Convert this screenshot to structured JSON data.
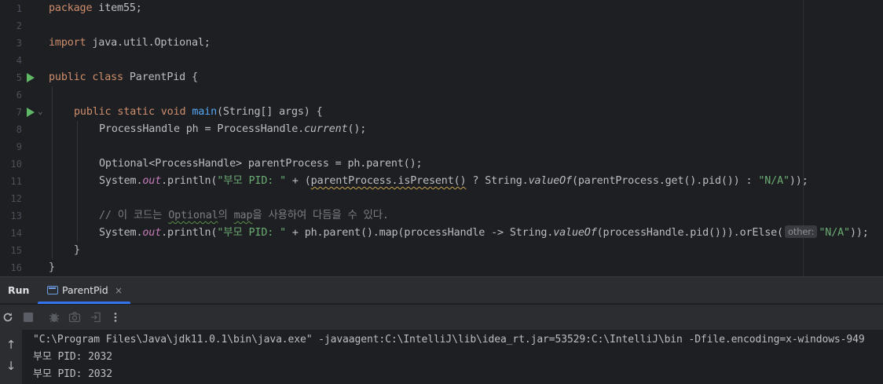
{
  "editor": {
    "line_numbers": [
      "1",
      "2",
      "3",
      "4",
      "5",
      "6",
      "7",
      "8",
      "9",
      "10",
      "11",
      "12",
      "13",
      "14",
      "15",
      "16"
    ],
    "line1": {
      "kw": "package",
      "rest": " item55;"
    },
    "line3": {
      "kw": "import",
      "rest": " java.util.Optional;"
    },
    "line5": {
      "kw": "public class",
      "rest": " ParentPid {"
    },
    "line7": {
      "kw": "public static void",
      "fn": "main",
      "rest": "(String[] args) {"
    },
    "line8": {
      "a": "ProcessHandle ph = ProcessHandle.",
      "b": "current",
      "c": "();"
    },
    "line10": {
      "a": "Optional<ProcessHandle> parentProcess = ph.parent();"
    },
    "line11": {
      "a": "System.",
      "field": "out",
      "b": ".println(",
      "str1": "\"부모 PID: \"",
      "c": " + (",
      "warn": "parentProcess.isPresent()",
      "d": " ? String.",
      "ital": "valueOf",
      "e": "(parentProcess.get().pid()) : ",
      "str2": "\"N/A\"",
      "f": "));"
    },
    "line13": {
      "a": "// 이 코드는 ",
      "typo1": "Optional",
      "b": "의 ",
      "typo2": "map",
      "c": "을 사용하여 다듬을 수 있다."
    },
    "line14": {
      "a": "System.",
      "field": "out",
      "b": ".println(",
      "str1": "\"부모 PID: \"",
      "c": " + ph.parent().map(processHandle -> String.",
      "ital": "valueOf",
      "d": "(processHandle.pid())).orElse(",
      "hint": "other:",
      "str2": "\"N/A\"",
      "e": "));"
    },
    "line15": {
      "a": "}"
    },
    "line16": {
      "a": "}"
    }
  },
  "run_panel": {
    "title": "Run",
    "tab_label": "ParentPid",
    "tab_close": "×",
    "toolbar_icons": [
      "rerun-icon",
      "stop-icon",
      "debug-icon",
      "camera-icon",
      "exit-icon",
      "more-icon"
    ],
    "up_arrow": "↑",
    "down_arrow": "↓",
    "console_lines": [
      "\"C:\\Program Files\\Java\\jdk11.0.1\\bin\\java.exe\" -javaagent:C:\\IntelliJ\\lib\\idea_rt.jar=53529:C:\\IntelliJ\\bin -Dfile.encoding=x-windows-949",
      "부모 PID: 2032",
      "부모 PID: 2032"
    ]
  },
  "colors": {
    "background": "#1e1f22",
    "keyword": "#cf8e6d",
    "string": "#6aab73",
    "function": "#56a8f5",
    "field": "#c77dbb",
    "comment": "#7a7e85",
    "accent": "#3574f0",
    "run_green": "#5fb865"
  }
}
